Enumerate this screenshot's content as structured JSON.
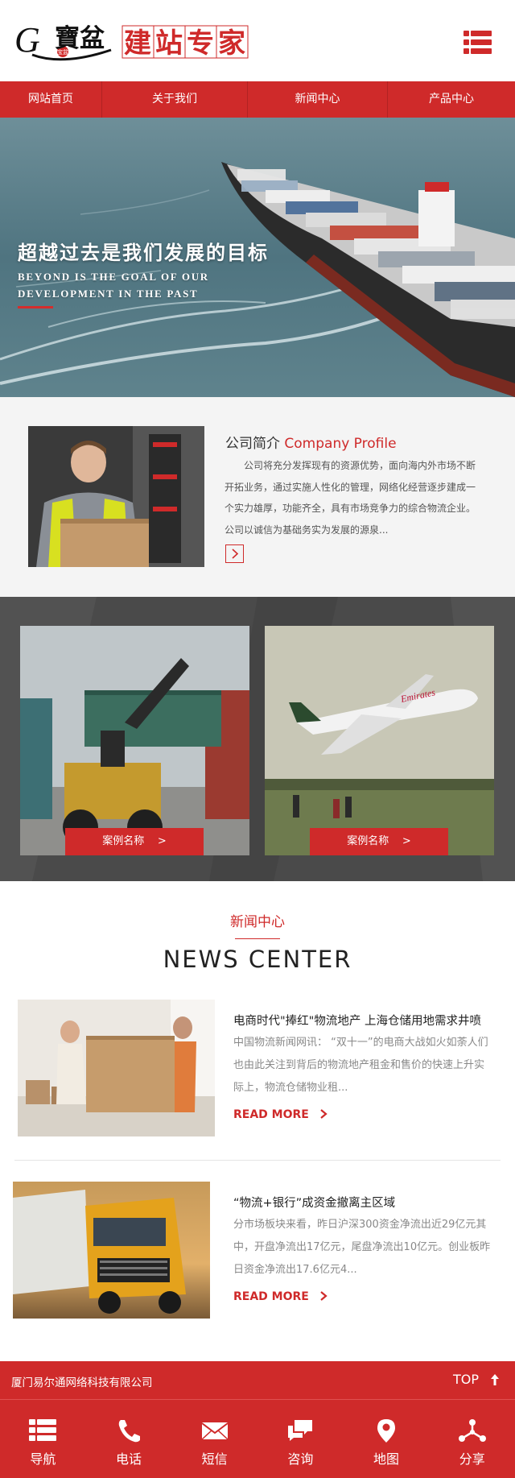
{
  "header": {
    "logo_cn": "寶盆",
    "logo_main": "建站专家",
    "logo_letter": "G",
    "logo_seal": "宝盆"
  },
  "nav": [
    "网站首页",
    "关于我们",
    "新闻中心",
    "产品中心"
  ],
  "banner": {
    "title": "超越过去是我们发展的目标",
    "subtitle": "BEYOND IS THE GOAL OF OUR DEVELOPMENT IN THE PAST"
  },
  "profile": {
    "title_cn": "公司简介",
    "title_en": "Company Profile",
    "text": "公司将充分发挥现有的资源优势，面向海内外市场不断开拓业务，通过实施人性化的管理，网络化经营逐步建成一个实力雄厚，功能齐全，具有市场竞争力的综合物流企业。 公司以诚信为基础务实为发展的源泉..."
  },
  "cases": [
    {
      "label": "案例名称",
      "arrow": ">"
    },
    {
      "label": "案例名称",
      "arrow": ">"
    }
  ],
  "news": {
    "heading_cn": "新闻中心",
    "heading_en": "NEWS CENTER",
    "items": [
      {
        "title": "电商时代\"捧红\"物流地产 上海仓储用地需求井喷",
        "desc": "中国物流新闻网讯： “双十一”的电商大战如火如荼人们也由此关注到背后的物流地产租金和售价的快速上升实际上，物流仓储物业租...",
        "more": "READ MORE"
      },
      {
        "title": "“物流+银行”成资金撤离主区域",
        "desc": "分市场板块来看，昨日沪深300资金净流出近29亿元其中，开盘净流出17亿元，尾盘净流出10亿元。创业板昨日资金净流出17.6亿元4...",
        "more": "READ MORE"
      }
    ]
  },
  "footer": {
    "company": "厦门易尔通网络科技有限公司",
    "top": "TOP"
  },
  "bottom_nav": [
    {
      "label": "导航",
      "icon": "list-icon"
    },
    {
      "label": "电话",
      "icon": "phone-icon"
    },
    {
      "label": "短信",
      "icon": "envelope-icon"
    },
    {
      "label": "咨询",
      "icon": "chat-icon"
    },
    {
      "label": "地图",
      "icon": "map-pin-icon"
    },
    {
      "label": "分享",
      "icon": "share-icon"
    }
  ],
  "colors": {
    "brand": "#cf2a2a",
    "dark_band": "#4a4a4a",
    "light_band": "#f4f4f4"
  }
}
